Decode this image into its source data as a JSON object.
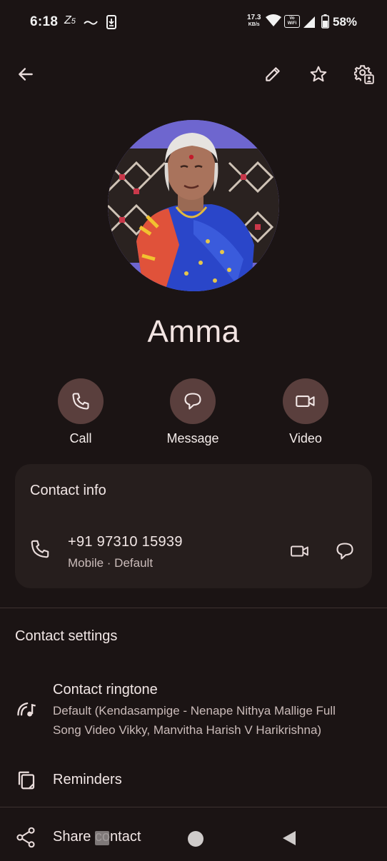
{
  "status_bar": {
    "time": "6:18",
    "speed_value": "17.3",
    "speed_unit": "KB/s",
    "vowifi": "Vo WiFi",
    "battery": "58%"
  },
  "contact": {
    "name": "Amma"
  },
  "actions": {
    "call": "Call",
    "message": "Message",
    "video": "Video"
  },
  "contact_info": {
    "title": "Contact info",
    "phone": "+91 97310 15939",
    "phone_type": "Mobile · Default"
  },
  "contact_settings": {
    "title": "Contact settings",
    "ringtone_title": "Contact ringtone",
    "ringtone_value": "Default (Kendasampige - Nenape Nithya Mallige Full Song Video  Vikky, Manvitha Harish  V Harikrishna)",
    "reminders": "Reminders",
    "share": "Share contact"
  },
  "colors": {
    "background": "#1b1414",
    "card": "#261e1d",
    "action_circle": "#5a3f3d",
    "text_primary": "#f2e7e6",
    "text_secondary": "#cbbcba"
  }
}
